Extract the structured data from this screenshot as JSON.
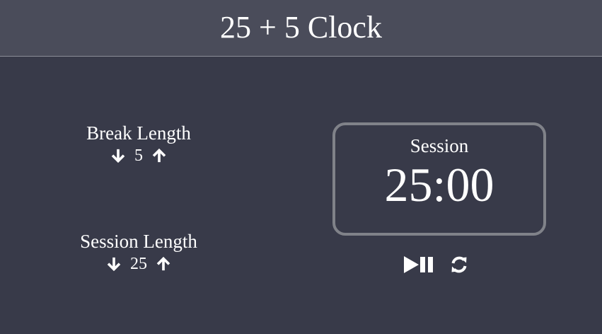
{
  "header": {
    "title": "25 + 5 Clock"
  },
  "break": {
    "label": "Break Length",
    "value": "5",
    "decrement_icon": "arrow-down-icon",
    "increment_icon": "arrow-up-icon"
  },
  "session": {
    "label": "Session Length",
    "value": "25",
    "decrement_icon": "arrow-down-icon",
    "increment_icon": "arrow-up-icon"
  },
  "timer": {
    "label": "Session",
    "time_left": "25:00"
  },
  "controls": {
    "start_stop_icon": "play-pause-icon",
    "reset_icon": "refresh-icon"
  },
  "colors": {
    "background": "#383a49",
    "header": "#4a4c5a",
    "timer_border": "#808289",
    "text": "#ffffff"
  }
}
